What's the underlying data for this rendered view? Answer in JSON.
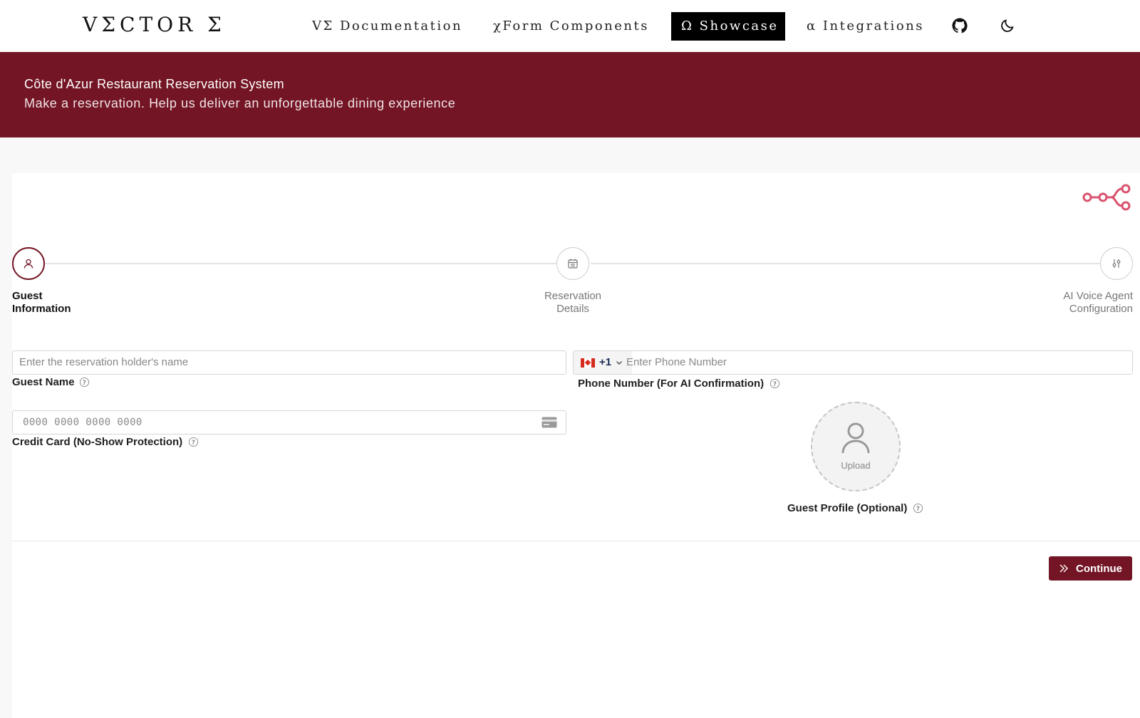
{
  "nav": {
    "brand": "VΣCTOR Σ",
    "links": [
      {
        "label": "VΣ Documentation",
        "active": false
      },
      {
        "label": "χForm Components",
        "active": false
      },
      {
        "label": "Ω Showcase",
        "active": true
      },
      {
        "label": "α Integrations",
        "active": false
      }
    ],
    "icons": [
      "github-icon",
      "moon-icon"
    ]
  },
  "banner": {
    "title": "Côte d'Azur Restaurant Reservation System",
    "subtitle": "Make a reservation. Help us deliver an unforgettable dining experience"
  },
  "stepper": {
    "steps": [
      {
        "label_line1": "Guest",
        "label_line2": "Information",
        "icon": "user-icon",
        "active": true
      },
      {
        "label_line1": "Reservation",
        "label_line2": "Details",
        "icon": "calendar-icon",
        "active": false
      },
      {
        "label_line1": "AI Voice Agent",
        "label_line2": "Configuration",
        "icon": "sliders-icon",
        "active": false
      }
    ]
  },
  "form": {
    "guest_name": {
      "placeholder": "Enter the reservation holder's name",
      "label": "Guest Name"
    },
    "phone": {
      "dial_code": "+1",
      "placeholder": "Enter Phone Number",
      "label": "Phone Number (For AI Confirmation)"
    },
    "credit_card": {
      "placeholder": "0000 0000 0000 0000",
      "label": "Credit Card (No-Show Protection)"
    },
    "profile": {
      "upload_text": "Upload",
      "label": "Guest Profile (Optional)"
    }
  },
  "actions": {
    "continue_label": "Continue"
  },
  "colors": {
    "accent": "#731524",
    "flow_icon": "#d9536f"
  }
}
